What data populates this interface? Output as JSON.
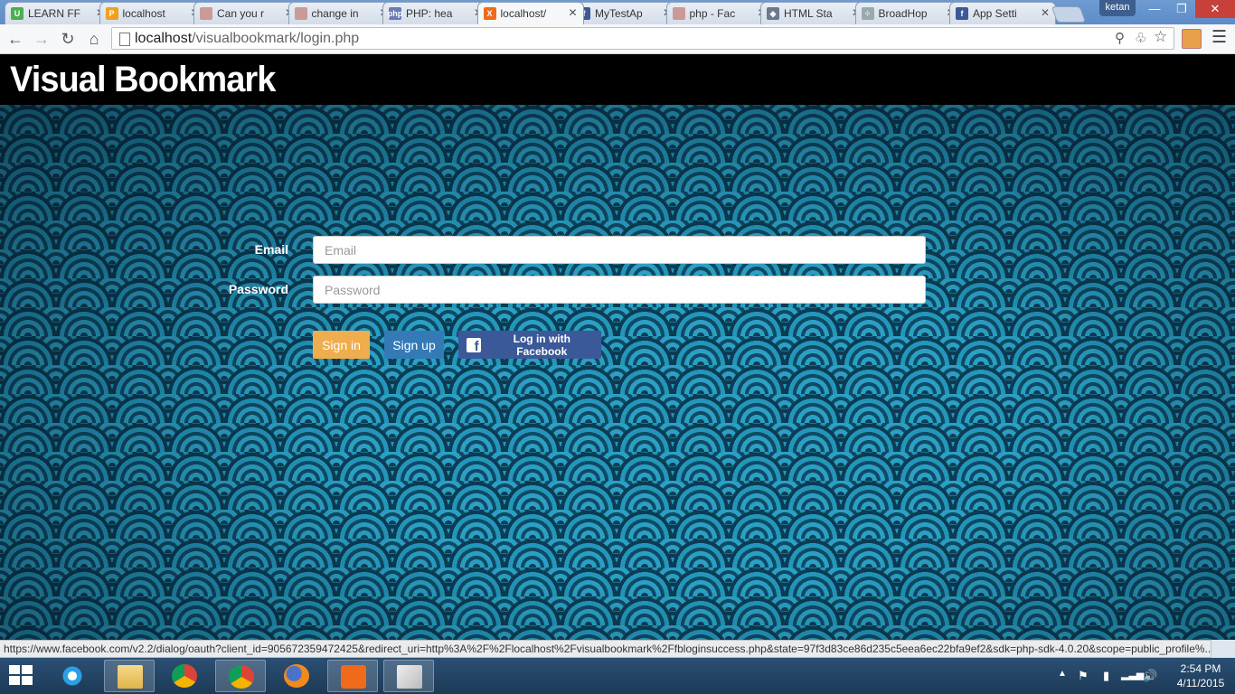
{
  "browser": {
    "tabs": [
      {
        "label": "LEARN FF",
        "favicon": "udemy-icon",
        "color": "#4caf50",
        "glyph": "U"
      },
      {
        "label": "localhost",
        "favicon": "phpmyadmin-icon",
        "color": "#f0a020",
        "glyph": "P"
      },
      {
        "label": "Can you r",
        "favicon": "stackoverflow-icon",
        "color": "#c99",
        "glyph": ""
      },
      {
        "label": "change in",
        "favicon": "stackoverflow-icon",
        "color": "#c99",
        "glyph": ""
      },
      {
        "label": "PHP: hea",
        "favicon": "php-icon",
        "color": "#6b7bb3",
        "glyph": "php"
      },
      {
        "label": "localhost/",
        "favicon": "xampp-icon",
        "color": "#f06a1c",
        "glyph": "X",
        "active": true
      },
      {
        "label": "MyTestAp",
        "favicon": "facebook-icon",
        "color": "#3b5998",
        "glyph": "f"
      },
      {
        "label": "php - Fac",
        "favicon": "stackoverflow-icon",
        "color": "#c99",
        "glyph": ""
      },
      {
        "label": "HTML Sta",
        "favicon": "diamond-icon",
        "color": "#6a7a8c",
        "glyph": "◈"
      },
      {
        "label": "BroadHop",
        "favicon": "dots-icon",
        "color": "#9aa",
        "glyph": "⁘"
      },
      {
        "label": "App Setti",
        "favicon": "facebook-icon",
        "color": "#3b5998",
        "glyph": "f"
      }
    ],
    "profile_name": "ketan",
    "url_host": "localhost",
    "url_path": "/visualbookmark/login.php"
  },
  "site": {
    "title": "Visual Bookmark"
  },
  "login_form": {
    "email_label": "Email",
    "email_placeholder": "Email",
    "password_label": "Password",
    "password_placeholder": "Password",
    "signin_label": "Sign in",
    "signup_label": "Sign up",
    "facebook_label": "Log in with Facebook"
  },
  "status_bar": {
    "url": "https://www.facebook.com/v2.2/dialog/oauth?client_id=905672359472425&redirect_uri=http%3A%2F%2Flocalhost%2Fvisualbookmark%2Ffbloginsuccess.php&state=97f3d83ce86d235c5eea6ec22bfa9ef2&sdk=php-sdk-4.0.20&scope=public_profile%..."
  },
  "taskbar": {
    "apps": [
      "internet-explorer-icon",
      "file-explorer-icon",
      "chrome-icon",
      "chrome-icon",
      "firefox-icon",
      "xampp-icon",
      "notepad-icon"
    ],
    "time": "2:54 PM",
    "date": "4/11/2015"
  }
}
